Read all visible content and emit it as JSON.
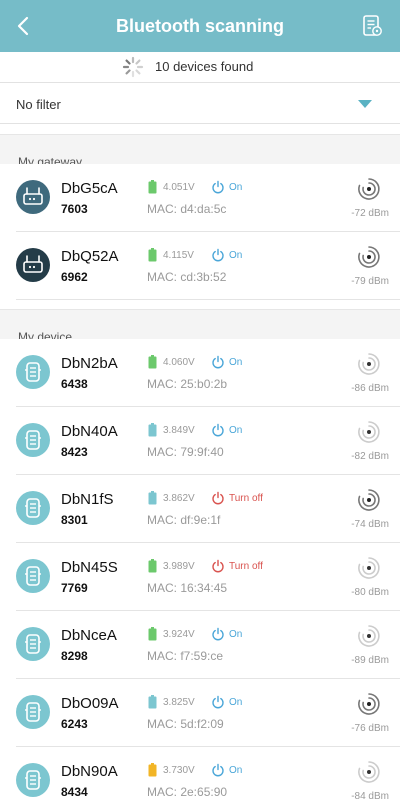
{
  "header": {
    "title": "Bluetooth scanning"
  },
  "scan": {
    "status": "10 devices found"
  },
  "filter": {
    "label": "No filter"
  },
  "sections": {
    "gateway": "My gateway",
    "device": "My device"
  },
  "colors": {
    "header_bg": "#76bcc8",
    "battery_green": "#6cc96c",
    "battery_blue": "#7cc6d0",
    "battery_yellow": "#f2b526",
    "state_on": "#4aa6d8",
    "state_off": "#d9534f"
  },
  "gateways": [
    {
      "name": "DbG5cA",
      "id": "7603",
      "voltage": "4.051V",
      "state": "On",
      "mac": "MAC: d4:da:5c",
      "rssi": "-72 dBm",
      "battery_color": "green",
      "icon": "gateway-icon"
    },
    {
      "name": "DbQ52A",
      "id": "6962",
      "voltage": "4.115V",
      "state": "On",
      "mac": "MAC: cd:3b:52",
      "rssi": "-79 dBm",
      "battery_color": "green",
      "icon": "gateway-icon"
    }
  ],
  "devices": [
    {
      "name": "DbN2bA",
      "id": "6438",
      "voltage": "4.060V",
      "state": "On",
      "mac": "MAC: 25:b0:2b",
      "rssi": "-86 dBm",
      "battery_color": "green",
      "state_color": "on",
      "icon": "sensor-device-icon"
    },
    {
      "name": "DbN40A",
      "id": "8423",
      "voltage": "3.849V",
      "state": "On",
      "mac": "MAC: 79:9f:40",
      "rssi": "-82 dBm",
      "battery_color": "blue",
      "state_color": "on",
      "icon": "sensor-device-icon"
    },
    {
      "name": "DbN1fS",
      "id": "8301",
      "voltage": "3.862V",
      "state": "Turn off",
      "mac": "MAC: df:9e:1f",
      "rssi": "-74 dBm",
      "battery_color": "blue",
      "state_color": "off",
      "icon": "sensor-device-icon"
    },
    {
      "name": "DbN45S",
      "id": "7769",
      "voltage": "3.989V",
      "state": "Turn off",
      "mac": "MAC: 16:34:45",
      "rssi": "-80 dBm",
      "battery_color": "green",
      "state_color": "off",
      "icon": "sensor-device-icon"
    },
    {
      "name": "DbNceA",
      "id": "8298",
      "voltage": "3.924V",
      "state": "On",
      "mac": "MAC: f7:59:ce",
      "rssi": "-89 dBm",
      "battery_color": "green",
      "state_color": "on",
      "icon": "sensor-device-icon"
    },
    {
      "name": "DbO09A",
      "id": "6243",
      "voltage": "3.825V",
      "state": "On",
      "mac": "MAC: 5d:f2:09",
      "rssi": "-76 dBm",
      "battery_color": "blue",
      "state_color": "on",
      "icon": "sensor-device-icon"
    },
    {
      "name": "DbN90A",
      "id": "8434",
      "voltage": "3.730V",
      "state": "On",
      "mac": "MAC: 2e:65:90",
      "rssi": "-84 dBm",
      "battery_color": "yellow",
      "state_color": "on",
      "icon": "sensor-device-icon"
    }
  ]
}
